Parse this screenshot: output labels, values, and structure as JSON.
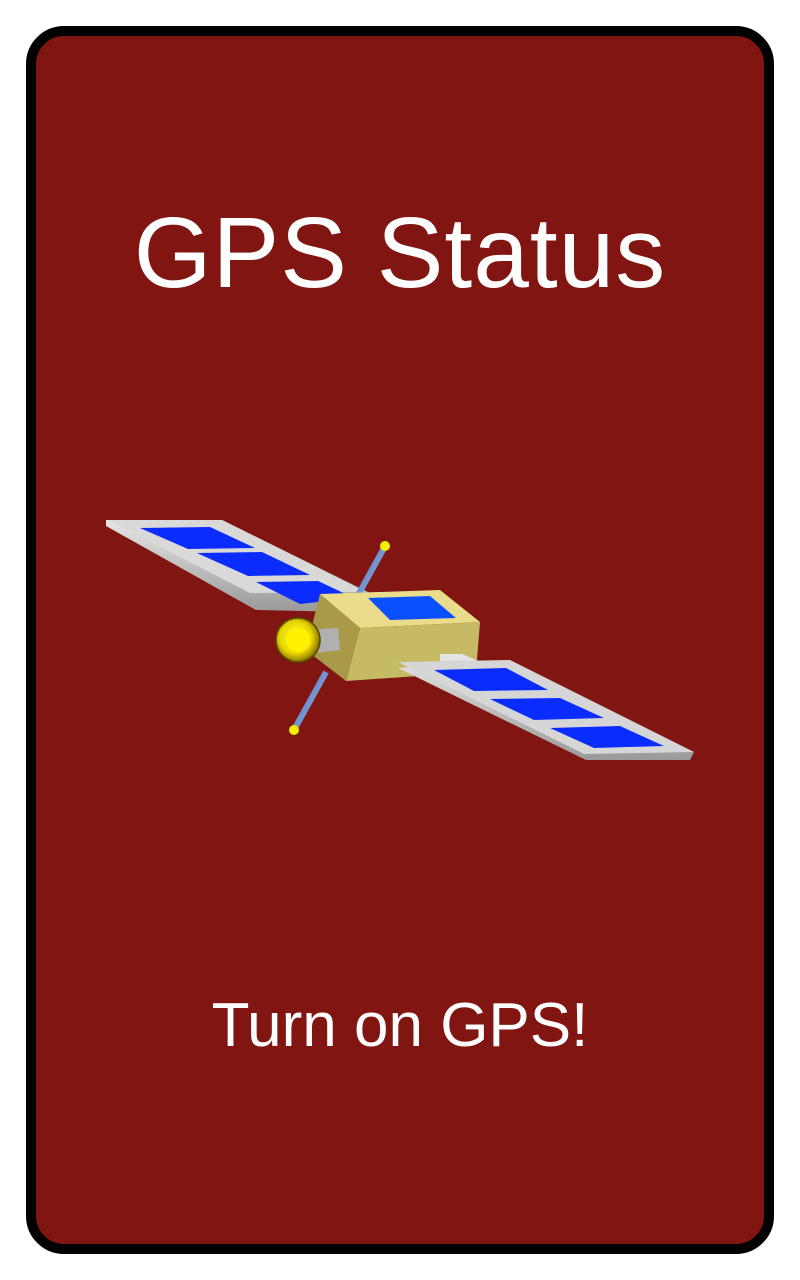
{
  "screen": {
    "title": "GPS Status",
    "status_message": "Turn on GPS!",
    "illustration_icon": "satellite-icon"
  },
  "colors": {
    "page_background": "#ffffff",
    "card_background": "#811511",
    "card_border": "#000000",
    "text": "#ffffff",
    "solar_panel": "#0033ff",
    "panel_frame": "#c8c8c8",
    "body": "#c9bd6a",
    "antenna_tip": "#f2ee00"
  }
}
